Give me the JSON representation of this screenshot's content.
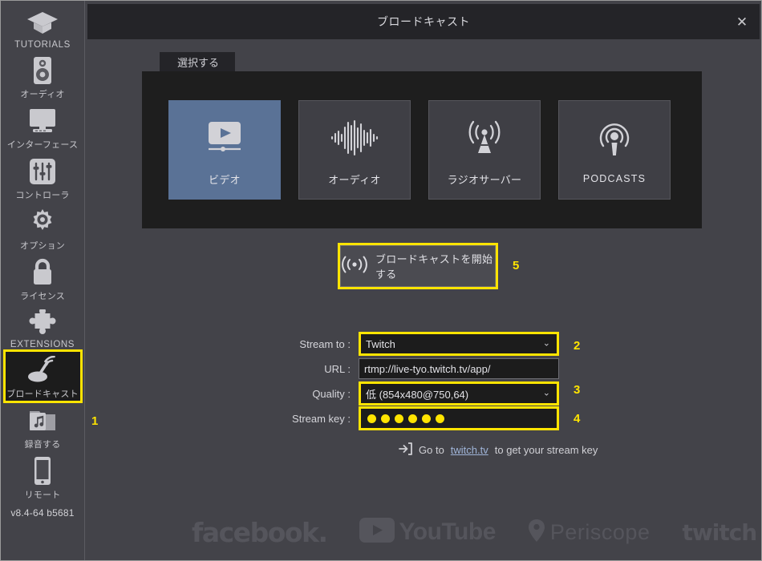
{
  "window": {
    "title": "ブロードキャスト",
    "close_label": "✕",
    "version": "v8.4-64 b5681"
  },
  "sidebar": {
    "items": [
      {
        "label": "TUTORIALS",
        "icon": "graduation-cap-icon",
        "latin": true,
        "active": false
      },
      {
        "label": "オーディオ",
        "icon": "speaker-icon",
        "latin": false,
        "active": false
      },
      {
        "label": "インターフェース",
        "icon": "monitor-icon",
        "latin": false,
        "active": false
      },
      {
        "label": "コントローラ",
        "icon": "sliders-icon",
        "latin": false,
        "active": false
      },
      {
        "label": "オプション",
        "icon": "gear-icon",
        "latin": false,
        "active": false
      },
      {
        "label": "ライセンス",
        "icon": "lock-icon",
        "latin": false,
        "active": false
      },
      {
        "label": "EXTENSIONS",
        "icon": "puzzle-icon",
        "latin": true,
        "active": false
      },
      {
        "label": "ブロードキャスト",
        "icon": "broadcast-icon",
        "latin": false,
        "active": true
      },
      {
        "label": "録音する",
        "icon": "music-folder-icon",
        "latin": false,
        "active": false
      },
      {
        "label": "リモート",
        "icon": "phone-icon",
        "latin": false,
        "active": false
      }
    ]
  },
  "tabs": [
    {
      "label": "選択する",
      "active": true
    }
  ],
  "tiles": [
    {
      "label": "ビデオ",
      "icon": "video-icon",
      "latin": false,
      "selected": true
    },
    {
      "label": "オーディオ",
      "icon": "waveform-icon",
      "latin": false,
      "selected": false
    },
    {
      "label": "ラジオサーバー",
      "icon": "radio-tower-icon",
      "latin": false,
      "selected": false
    },
    {
      "label": "PODCASTS",
      "icon": "podcast-icon",
      "latin": true,
      "selected": false
    }
  ],
  "start_button": {
    "label": "ブロードキャストを開始する",
    "icon": "broadcast-waves-icon"
  },
  "form": {
    "stream_to": {
      "label": "Stream to :",
      "value": "Twitch"
    },
    "url": {
      "label": "URL :",
      "value": "rtmp://live-tyo.twitch.tv/app/"
    },
    "quality": {
      "label": "Quality :",
      "value": "低 (854x480@750,64)"
    },
    "stream_key": {
      "label": "Stream key :",
      "masked_dots": 6
    }
  },
  "helper": {
    "prefix": "Go to",
    "link": "twitch.tv",
    "suffix": "to get your stream key",
    "icon": "login-arrow-icon"
  },
  "logos": [
    {
      "name": "facebook",
      "text": "facebook."
    },
    {
      "name": "youtube",
      "text": "YouTube"
    },
    {
      "name": "periscope",
      "text": "Periscope"
    },
    {
      "name": "twitch",
      "text": "twitch"
    }
  ],
  "annotations": [
    {
      "number": "1",
      "target": "sidebar-broadcast"
    },
    {
      "number": "2",
      "target": "stream-to"
    },
    {
      "number": "3",
      "target": "quality"
    },
    {
      "number": "4",
      "target": "stream-key"
    },
    {
      "number": "5",
      "target": "start-broadcast"
    }
  ],
  "colors": {
    "highlight": "#ffe400",
    "accent_selected": "#5a7296",
    "panel_bg": "#434349",
    "dark_bg": "#1e1e1e"
  }
}
